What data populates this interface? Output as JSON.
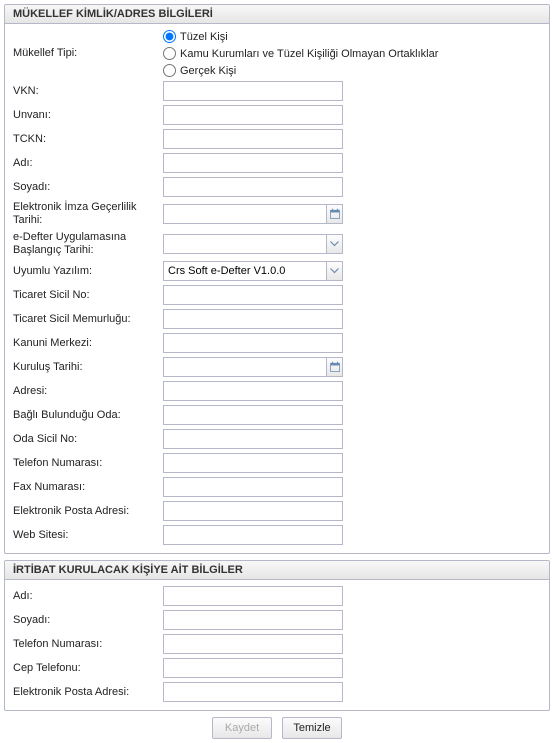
{
  "section1": {
    "title": "MÜKELLEF KİMLİK/ADRES BİLGİLERİ",
    "mukellef_tipi_label": "Mükellef Tipi:",
    "radio_tuzel": "Tüzel Kişi",
    "radio_kamu": "Kamu Kurumları ve Tüzel Kişiliği Olmayan Ortaklıklar",
    "radio_gercek": "Gerçek Kişi",
    "vkn_label": "VKN:",
    "vkn_value": "",
    "unvani_label": "Unvanı:",
    "unvani_value": "",
    "tckn_label": "TCKN:",
    "tckn_value": "",
    "adi_label": "Adı:",
    "adi_value": "",
    "soyadi_label": "Soyadı:",
    "soyadi_value": "",
    "eimza_label": "Elektronik İmza Geçerlilik Tarihi:",
    "eimza_value": "",
    "edefter_label": "e-Defter Uygulamasına Başlangıç Tarihi:",
    "edefter_value": "",
    "yazilim_label": "Uyumlu Yazılım:",
    "yazilim_value": "Crs Soft e-Defter V1.0.0",
    "tsicilno_label": "Ticaret Sicil No:",
    "tsicilno_value": "",
    "tsicilmem_label": "Ticaret Sicil Memurluğu:",
    "tsicilmem_value": "",
    "kmerkezi_label": "Kanuni Merkezi:",
    "kmerkezi_value": "",
    "kurulus_label": "Kuruluş Tarihi:",
    "kurulus_value": "",
    "adresi_label": "Adresi:",
    "adresi_value": "",
    "bagli_label": "Bağlı Bulunduğu Oda:",
    "bagli_value": "",
    "odasicil_label": "Oda Sicil No:",
    "odasicil_value": "",
    "telefon_label": "Telefon Numarası:",
    "telefon_value": "",
    "fax_label": "Fax Numarası:",
    "fax_value": "",
    "eposta_label": "Elektronik Posta Adresi:",
    "eposta_value": "",
    "web_label": "Web Sitesi:",
    "web_value": ""
  },
  "section2": {
    "title": "İRTİBAT KURULACAK KİŞİYE AİT BİLGİLER",
    "adi_label": "Adı:",
    "adi_value": "",
    "soyadi_label": "Soyadı:",
    "soyadi_value": "",
    "telefon_label": "Telefon Numarası:",
    "telefon_value": "",
    "cep_label": "Cep Telefonu:",
    "cep_value": "",
    "eposta_label": "Elektronik Posta Adresi:",
    "eposta_value": ""
  },
  "buttons": {
    "kaydet": "Kaydet",
    "temizle": "Temizle"
  }
}
